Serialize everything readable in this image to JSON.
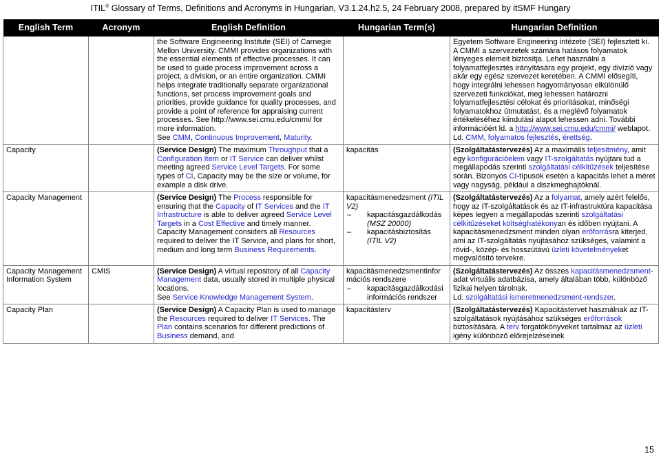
{
  "document": {
    "header_prefix": "ITIL",
    "header_sup": "®",
    "header_rest": " Glossary of Terms, Definitions and Acronyms in Hungarian, V3.1.24.h2.5, 24 February 2008, prepared by itSMF Hungary",
    "page_number": "15"
  },
  "table": {
    "columns": [
      {
        "label": "English Term"
      },
      {
        "label": "Acronym"
      },
      {
        "label": "English Definition"
      },
      {
        "label": "Hungarian Term(s)"
      },
      {
        "label": "Hungarian Definition"
      }
    ],
    "rows": [
      {
        "english_term": "",
        "acronym": "",
        "english_definition_plain": "the Software Engineering Institute (SEI) of Carnegie Mellon University. CMMI provides organizations with the essential elements of effective processes. It can be used to guide process improvement across a project, a division, or an entire organization. CMMI helps integrate traditionally separate organizational functions, set process improvement goals and priorities, provide guidance for quality processes, and provide a point of reference for appraising current processes. See http://www.sei.cmu.edu/cmmi/ for more information.",
        "english_definition_see": "See ",
        "english_refs": [
          "CMM",
          "Continuous Improvement",
          "Maturity"
        ],
        "hungarian_term": "",
        "hungarian_definition_plain": "Egyetem Software Engineering intézete (SEI) fejlesztett ki. A CMMI a szervezetek számára hatásos folyamatok lényeges elemeit biztosítja. Lehet használni a folyamatfejlesztés irányítására egy projekt, egy divízió vagy akár egy egész szervezet keretében. A CMMI elősegíti, hogy integrálni lehessen hagyományosan elkülönülő szervezeti funkciókat, meg lehessen határozni folyamatfejlesztési célokat és prioritásokat, minőségi folyamatokhoz útmutatást, és a meglévő folyamatok értékeléséhez kiindulási alapot lehessen adni. További információért ld. a ",
        "hungarian_url": "http://www.sei.cmu.edu/cmmi/",
        "hungarian_after_url": " weblapot.",
        "hungarian_definition_see": "Ld. ",
        "hungarian_refs": [
          "CMM",
          "folyamatos fejlesztés",
          "érettség"
        ]
      },
      {
        "english_term": "Capacity",
        "acronym": "",
        "english_definition_parts": [
          {
            "text": "(Service Design)",
            "style": "bold"
          },
          {
            "text": " The maximum ",
            "style": "plain"
          },
          {
            "text": "Throughput",
            "style": "ref"
          },
          {
            "text": " that a ",
            "style": "plain"
          },
          {
            "text": "Configuration Item",
            "style": "ref"
          },
          {
            "text": " or ",
            "style": "plain"
          },
          {
            "text": "IT Service",
            "style": "ref"
          },
          {
            "text": " can deliver whilst meeting agreed ",
            "style": "plain"
          },
          {
            "text": "Service Level Targets",
            "style": "ref"
          },
          {
            "text": ". For some types of ",
            "style": "plain"
          },
          {
            "text": "CI",
            "style": "ref"
          },
          {
            "text": ", Capacity may be the size or volume, for example a disk drive.",
            "style": "plain"
          }
        ],
        "hungarian_term": "kapacitás",
        "hungarian_definition_parts": [
          {
            "text": "(Szolgáltatástervezés)",
            "style": "bold"
          },
          {
            "text": " Az a maximális ",
            "style": "plain"
          },
          {
            "text": "teljesítmény",
            "style": "ref"
          },
          {
            "text": ", amit egy ",
            "style": "plain"
          },
          {
            "text": "konfigurációelem",
            "style": "ref"
          },
          {
            "text": " vagy ",
            "style": "plain"
          },
          {
            "text": "IT-szolgáltatás",
            "style": "ref"
          },
          {
            "text": " nyújtani tud a megállapodás szerinti ",
            "style": "plain"
          },
          {
            "text": "szolgáltatási célkitűzések",
            "style": "ref"
          },
          {
            "text": " teljesítése során. Bizonyos ",
            "style": "plain"
          },
          {
            "text": "CI",
            "style": "ref"
          },
          {
            "text": "-típusok esetén a kapacitás lehet a méret vagy nagyság, például a diszkmeghajtóknál.",
            "style": "plain"
          }
        ]
      },
      {
        "english_term": "Capacity Management",
        "acronym": "",
        "english_definition_parts": [
          {
            "text": "(Service Design)",
            "style": "bold"
          },
          {
            "text": " The ",
            "style": "plain"
          },
          {
            "text": "Process",
            "style": "ref"
          },
          {
            "text": " responsible for ensuring that the ",
            "style": "plain"
          },
          {
            "text": "Capacity",
            "style": "ref"
          },
          {
            "text": " of ",
            "style": "plain"
          },
          {
            "text": "IT Services",
            "style": "ref"
          },
          {
            "text": " and the ",
            "style": "plain"
          },
          {
            "text": "IT Infrastructure",
            "style": "ref"
          },
          {
            "text": " is able to deliver agreed ",
            "style": "plain"
          },
          {
            "text": "Service Level Targets",
            "style": "ref"
          },
          {
            "text": " in a ",
            "style": "plain"
          },
          {
            "text": "Cost Effective",
            "style": "ref"
          },
          {
            "text": " and timely manner. Capacity Management considers all ",
            "style": "plain"
          },
          {
            "text": "Resources",
            "style": "ref"
          },
          {
            "text": " required to deliver the IT Service, and plans for short, medium and long term ",
            "style": "plain"
          },
          {
            "text": "Business Requirements",
            "style": "ref"
          },
          {
            "text": ".",
            "style": "plain"
          }
        ],
        "hungarian_term_main": "kapacitásmenedzsment",
        "hungarian_term_main_note": "(ITIL V2)",
        "hungarian_term_sublist": [
          {
            "text": "kapacitásgazdálkodás",
            "note": "(MSZ 20000)"
          },
          {
            "text": "kapacitásbiztosítás",
            "note": "(ITIL V2)"
          }
        ],
        "hungarian_definition_parts": [
          {
            "text": "(Szolgáltatástervezés)",
            "style": "bold"
          },
          {
            "text": " Az a ",
            "style": "plain"
          },
          {
            "text": "folyamat",
            "style": "ref"
          },
          {
            "text": ", amely azért felelős, hogy az IT-szolgáltatások és az IT-infrastruktúra kapacitása képes legyen a megállapodás szerinti ",
            "style": "plain"
          },
          {
            "text": "szolgáltatási célkitűzéseket",
            "style": "ref"
          },
          {
            "text": " ",
            "style": "plain"
          },
          {
            "text": "költséghatékony",
            "style": "ref"
          },
          {
            "text": "an és időben nyújtani. A kapacitásmenedzsment minden olyan ",
            "style": "plain"
          },
          {
            "text": "erőforrás",
            "style": "ref"
          },
          {
            "text": "ra kiterjed, ami az IT-szolgáltatás nyújtásához szükséges, valamint a rövid-, közép- és hosszútávú ",
            "style": "plain"
          },
          {
            "text": "üzleti követelmények",
            "style": "ref"
          },
          {
            "text": "et megvalósító tervekre.",
            "style": "plain"
          }
        ]
      },
      {
        "english_term": "Capacity Management Information System",
        "acronym": "CMIS",
        "english_definition_parts": [
          {
            "text": "(Service Design)",
            "style": "bold"
          },
          {
            "text": " A virtual repository of all ",
            "style": "plain"
          },
          {
            "text": "Capacity Management",
            "style": "ref"
          },
          {
            "text": " data, usually stored in multiple physical locations.",
            "style": "plain"
          },
          {
            "text": "\n",
            "style": "break"
          },
          {
            "text": "See ",
            "style": "plain"
          },
          {
            "text": "Service Knowledge Management System",
            "style": "ref"
          },
          {
            "text": ".",
            "style": "plain"
          }
        ],
        "hungarian_term_main": "kapacitásmenedzsmentinformációs rendszere",
        "hungarian_term_main_note": "",
        "hungarian_term_sublist": [
          {
            "text": "kapacitásgazdálkodási információs rendszer",
            "note": ""
          }
        ],
        "hungarian_definition_parts": [
          {
            "text": "(Szolgáltatástervezés)",
            "style": "bold"
          },
          {
            "text": " Az összes ",
            "style": "plain"
          },
          {
            "text": "kapacitásmenedzsment",
            "style": "ref"
          },
          {
            "text": "-adat virtuális adatbázisa, amely általában több, különböző fizikai helyen tárolnak.",
            "style": "plain"
          },
          {
            "text": "\n",
            "style": "break"
          },
          {
            "text": "Ld. ",
            "style": "plain"
          },
          {
            "text": "szolgáltatási ismeretmenedzsment-rendszer",
            "style": "ref"
          },
          {
            "text": ".",
            "style": "plain"
          }
        ]
      },
      {
        "english_term": "Capacity Plan",
        "acronym": "",
        "english_definition_parts": [
          {
            "text": "(Service Design)",
            "style": "bold"
          },
          {
            "text": " A Capacity Plan is used to manage the ",
            "style": "plain"
          },
          {
            "text": "Resources",
            "style": "ref"
          },
          {
            "text": " required to deliver ",
            "style": "plain"
          },
          {
            "text": "IT Services",
            "style": "ref"
          },
          {
            "text": ". The ",
            "style": "plain"
          },
          {
            "text": "Plan",
            "style": "ref"
          },
          {
            "text": " contains scenarios for different predictions of ",
            "style": "plain"
          },
          {
            "text": "Business",
            "style": "ref"
          },
          {
            "text": " demand, and",
            "style": "plain"
          }
        ],
        "hungarian_term": "kapacitásterv",
        "hungarian_definition_parts": [
          {
            "text": "(Szolgáltatástervezés)",
            "style": "bold"
          },
          {
            "text": " Kapacitástervet használnak az IT-szolgáltatások nyújtásához szükséges ",
            "style": "plain"
          },
          {
            "text": "erőforrások",
            "style": "ref"
          },
          {
            "text": " biztosítására. A ",
            "style": "plain"
          },
          {
            "text": "terv",
            "style": "ref"
          },
          {
            "text": " forgatókönyveket tartalmaz az ",
            "style": "plain"
          },
          {
            "text": "üzleti",
            "style": "ref"
          },
          {
            "text": " igény különböző előrejelzéseinek",
            "style": "plain"
          }
        ]
      }
    ]
  }
}
